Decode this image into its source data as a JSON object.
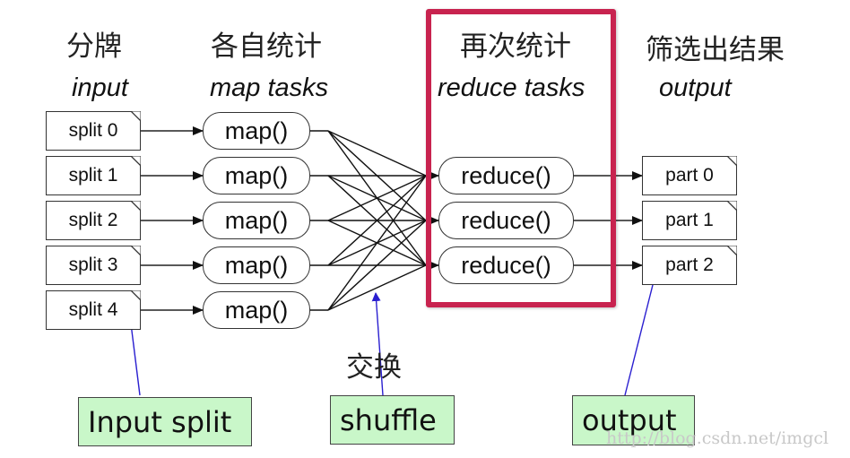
{
  "headers": {
    "input": {
      "cn": "分牌",
      "en": "input"
    },
    "map": {
      "cn": "各自统计",
      "en": "map tasks"
    },
    "reduce": {
      "cn": "再次统计",
      "en": "reduce tasks"
    },
    "output": {
      "cn": "筛选出结果",
      "en": "output"
    }
  },
  "splits": [
    "split 0",
    "split 1",
    "split 2",
    "split 3",
    "split 4"
  ],
  "maps": [
    "map()",
    "map()",
    "map()",
    "map()",
    "map()"
  ],
  "reduces": [
    "reduce()",
    "reduce()",
    "reduce()"
  ],
  "parts": [
    "part 0",
    "part 1",
    "part 2"
  ],
  "shuffle_label_cn": "交换",
  "notes": {
    "input_split": "Input split",
    "shuffle": "shuffle",
    "output": "output"
  },
  "highlight_color": "#c8234f",
  "note_color": "#c9f7c9",
  "callout_color": "#2a1fd0",
  "watermark": "http://blog.csdn.net/imgcl"
}
